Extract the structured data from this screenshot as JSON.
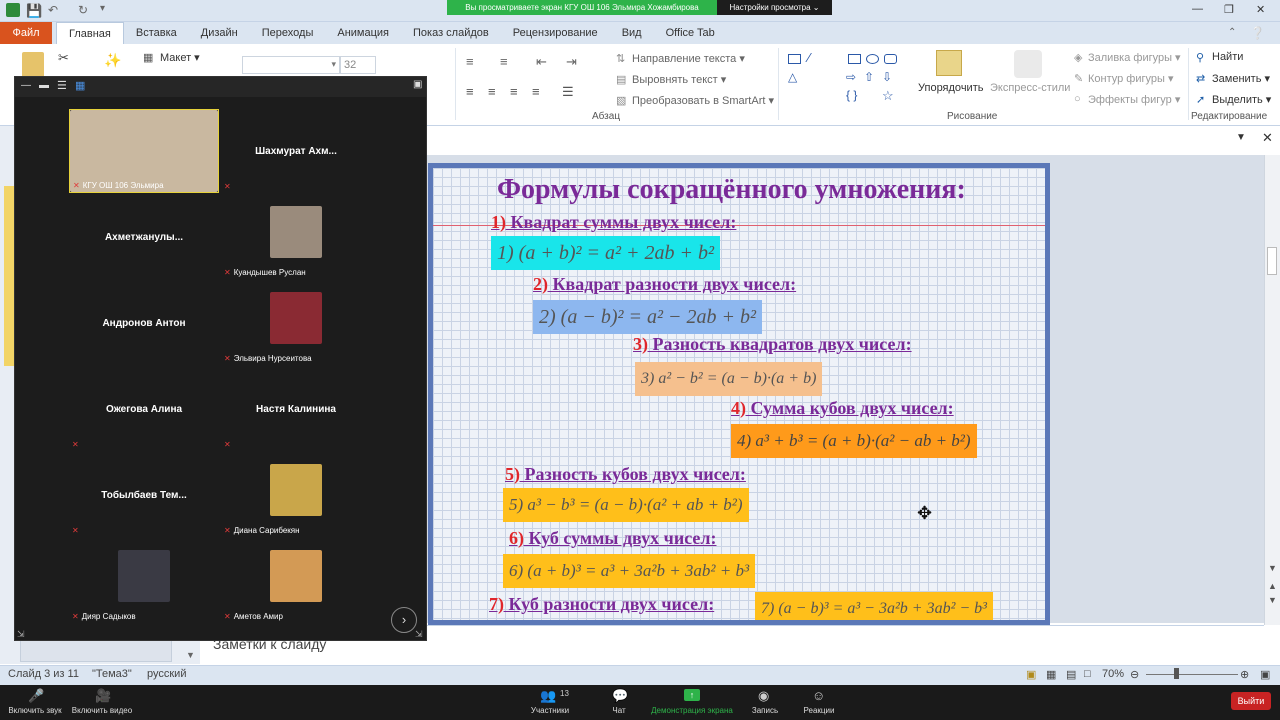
{
  "banner": {
    "viewing": "Вы просматриваете экран КГУ ОШ 106 Эльмира Хожамбирова",
    "settings": "Настройки просмотра ⌄"
  },
  "ribbon_tabs": [
    "Файл",
    "Главная",
    "Вставка",
    "Дизайн",
    "Переходы",
    "Анимация",
    "Показ слайдов",
    "Рецензирование",
    "Вид",
    "Office Tab"
  ],
  "ribbon": {
    "layout": "Макет ▾",
    "font_size": "32",
    "text_direction": "Направление текста ▾",
    "align_text": "Выровнять текст ▾",
    "smartart": "Преобразовать в SmartArt ▾",
    "paragraph": "Абзац",
    "arrange": "Упорядочить",
    "quick_styles": "Экспресс-стили",
    "shape_fill": "Заливка фигуры ▾",
    "shape_outline": "Контур фигуры ▾",
    "shape_effects": "Эффекты фигур ▾",
    "drawing": "Рисование",
    "find": "Найти",
    "replace": "Заменить ▾",
    "select": "Выделить ▾",
    "editing": "Редактирование"
  },
  "slide": {
    "title": "Формулы сокращённого умножения:",
    "items": [
      {
        "num": "1)",
        "heading": "Квадрат суммы двух чисел:",
        "formula": "1) (a + b)² = a² + 2ab + b²",
        "color": "#19e5ea"
      },
      {
        "num": "2)",
        "heading": "Квадрат разности двух чисел:",
        "formula": "2) (a − b)² = a² − 2ab + b²",
        "color": "#8db7ef"
      },
      {
        "num": "3)",
        "heading": "Разность квадратов двух чисел:",
        "formula": "3) a² − b² = (a − b)·(a + b)",
        "color": "#f5c08e"
      },
      {
        "num": "4)",
        "heading": "Сумма кубов двух чисел:",
        "formula": "4) a³ + b³ = (a + b)·(a² − ab + b²)",
        "color": "#ff9a1a"
      },
      {
        "num": "5)",
        "heading": "Разность кубов двух чисел:",
        "formula": "5) a³ − b³ = (a − b)·(a² + ab + b²)",
        "color": "#ffbf1a"
      },
      {
        "num": "6)",
        "heading": "Куб суммы двух чисел:",
        "formula": "6) (a + b)³ = a³ + 3a²b + 3ab² + b³",
        "color": "#ffbf1a"
      },
      {
        "num": "7)",
        "heading": "Куб разности двух чисел:",
        "formula": "7) (a − b)³ = a³ − 3a²b + 3ab² − b³",
        "color": "#ffbf1a"
      }
    ]
  },
  "notes_placeholder": "Заметки к слайду",
  "status": {
    "slide": "Слайд 3 из 11",
    "theme": "\"Тема3\"",
    "lang": "русский",
    "zoom": "70%"
  },
  "participants": [
    {
      "name": "КГУ ОШ 106 Эльмира",
      "has_video": true,
      "muted": true,
      "color": "#c9b8a0"
    },
    {
      "name": "Шахмурат  Ахм...",
      "has_video": false,
      "muted": true
    },
    {
      "name": "Ахметжанулы...",
      "has_video": false,
      "muted": false
    },
    {
      "name": "Куандышев Руслан",
      "has_video": true,
      "muted": true,
      "color": "#9a8b7c"
    },
    {
      "name": "Андронов Антон",
      "has_video": false,
      "muted": false
    },
    {
      "name": "Эльвира Нурсеитова",
      "has_video": true,
      "muted": true,
      "color": "#8a2a33"
    },
    {
      "name": "Ожегова Алина",
      "has_video": false,
      "muted": true
    },
    {
      "name": "Настя Калинина",
      "has_video": false,
      "muted": true
    },
    {
      "name": "Тобылбаев  Тем...",
      "has_video": false,
      "muted": true
    },
    {
      "name": "Диана Сарибекян",
      "has_video": true,
      "muted": true,
      "color": "#c9a64a"
    },
    {
      "name": "Дияр Садыков",
      "has_video": true,
      "muted": true,
      "color": "#3a3a44"
    },
    {
      "name": "Аметов Амир",
      "has_video": true,
      "muted": true,
      "color": "#d39a55"
    }
  ],
  "zoom_toolbar": {
    "mute": "Включить звук",
    "video": "Включить видео",
    "participants": "Участники",
    "participants_count": "13",
    "chat": "Чат",
    "share": "Демонстрация экрана",
    "record": "Запись",
    "reactions": "Реакции",
    "leave": "Выйти"
  }
}
